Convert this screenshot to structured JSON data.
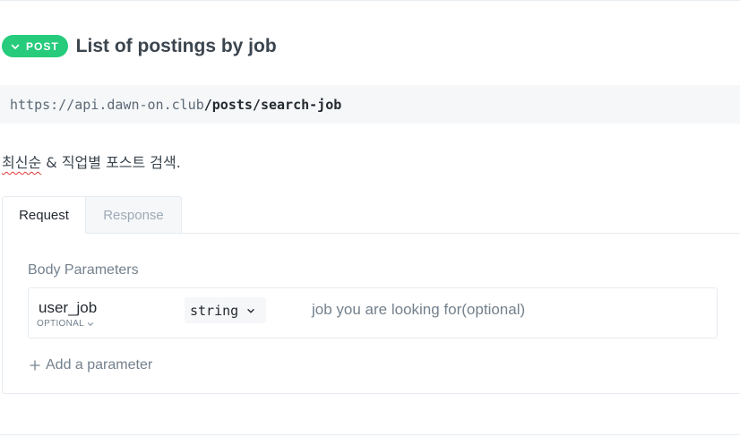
{
  "endpoint": {
    "method": "POST",
    "title": "List of postings by job",
    "url_base": "https://api.dawn-on.club",
    "url_path": "/posts/search-job",
    "description_underlined": "최신순",
    "description_rest": " & 직업별 포스트 검색."
  },
  "tabs": [
    {
      "label": "Request",
      "active": true
    },
    {
      "label": "Response",
      "active": false
    }
  ],
  "request": {
    "section_title": "Body Parameters",
    "params": [
      {
        "name": "user_job",
        "required_label": "OPTIONAL",
        "type": "string",
        "description": "job you are looking for(optional)"
      }
    ],
    "add_label": "Add a parameter"
  },
  "colors": {
    "accent": "#26cb7c",
    "text_primary": "#242a31",
    "text_secondary": "#74818d",
    "border": "#e6ecf1",
    "code_bg": "#f5f7f9"
  },
  "icons": {
    "badge": "chevron-down-icon",
    "optional": "chevron-down-icon",
    "type_select": "chevron-down-icon",
    "add": "plus-icon"
  }
}
